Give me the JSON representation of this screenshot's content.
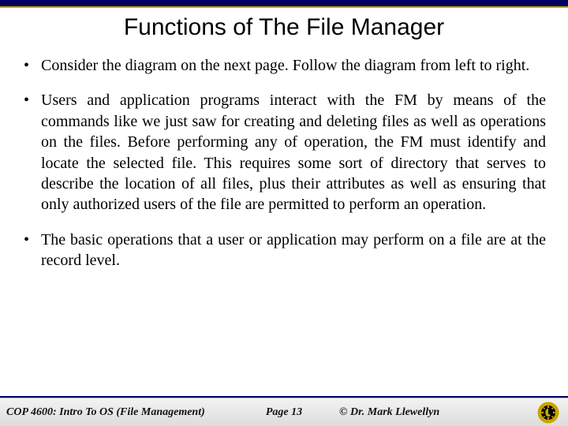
{
  "title": "Functions of The File Manager",
  "bullets": {
    "b0": "Consider the diagram on the next page. Follow the diagram from left to right.",
    "b1": "Users and application programs interact with the FM by means of the commands like we just saw for creating and deleting files as well as operations on the files.  Before performing any of operation, the FM must identify and locate the selected file.  This requires some sort of directory that serves to describe the location of all files, plus their attributes as well as ensuring that only authorized users of the file are permitted to perform an operation.",
    "b2": "The basic operations that a user or application may perform on a file are at the record level."
  },
  "footer": {
    "course": "COP 4600: Intro To OS  (File Management)",
    "page": "Page 13",
    "author": "© Dr. Mark Llewellyn"
  }
}
